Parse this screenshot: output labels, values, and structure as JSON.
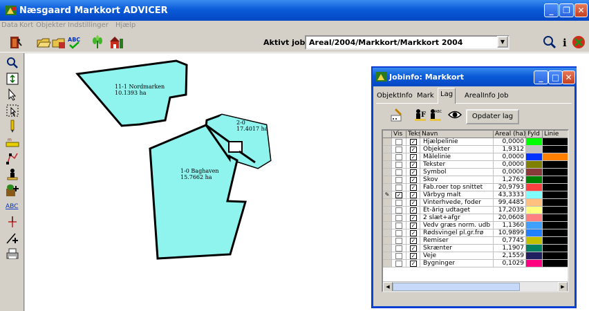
{
  "window": {
    "title": "Næsgaard Markkort ADVICER"
  },
  "menu": [
    "Data",
    "Kort",
    "Objekter",
    "Indstillinger",
    "Hjælp"
  ],
  "toolbar": {
    "aktivt_job_label": "Aktivt job",
    "job_value": "Areal/2004/Markkort/Markkort 2004"
  },
  "map": {
    "fields": [
      {
        "name": "11-1 Nordmarken",
        "area": "10.1393 ha"
      },
      {
        "name": "2-0",
        "area": "17.4017 ha"
      },
      {
        "name": "1-0 Baghaven",
        "area": "15.7662 ha"
      }
    ],
    "field_color": "#8ff3ee"
  },
  "jobinfo": {
    "title": "Jobinfo: Markkort",
    "tabs": [
      "ObjektInfo",
      "Mark",
      "Lag",
      "ArealInfo",
      "Job"
    ],
    "active_tab": "Lag",
    "update_button": "Opdater lag",
    "columns": [
      "Vis",
      "Tekst",
      "Navn",
      "Areal (ha)",
      "Fyld",
      "Linie"
    ],
    "rows": [
      {
        "vis": false,
        "tekst": true,
        "navn": "Hjælpelinie",
        "areal": "0,0000",
        "fyld": "#00ff00",
        "linie": "#000000"
      },
      {
        "vis": false,
        "tekst": true,
        "navn": "Objekter",
        "areal": "1,9312",
        "fyld": "#c0c0c0",
        "linie": "#000000"
      },
      {
        "vis": false,
        "tekst": true,
        "navn": "Målelinie",
        "areal": "0,0000",
        "fyld": "#0033ff",
        "linie": "#ff8000"
      },
      {
        "vis": false,
        "tekst": true,
        "navn": "Tekster",
        "areal": "0,0000",
        "fyld": "#808000",
        "linie": "#000000"
      },
      {
        "vis": false,
        "tekst": true,
        "navn": "Symbol",
        "areal": "0,0000",
        "fyld": "#8b3a3a",
        "linie": "#000000"
      },
      {
        "vis": false,
        "tekst": true,
        "navn": "Skov",
        "areal": "1,2762",
        "fyld": "#008000",
        "linie": "#000000"
      },
      {
        "vis": false,
        "tekst": true,
        "navn": "Fab.roer top snittet",
        "areal": "20,9793",
        "fyld": "#ff4040",
        "linie": "#000000"
      },
      {
        "vis": true,
        "tekst": true,
        "navn": "Vårbyg malt",
        "areal": "43,3333",
        "fyld": "#80ffff",
        "linie": "#000000",
        "selected": true
      },
      {
        "vis": false,
        "tekst": true,
        "navn": "Vinterhvede, foder",
        "areal": "99,4485",
        "fyld": "#ffc080",
        "linie": "#000000"
      },
      {
        "vis": false,
        "tekst": true,
        "navn": "Et-årig udtaget",
        "areal": "17,2039",
        "fyld": "#ffff80",
        "linie": "#000000"
      },
      {
        "vis": false,
        "tekst": true,
        "navn": "2 slæt+afgr",
        "areal": "20,0608",
        "fyld": "#ff8080",
        "linie": "#000000"
      },
      {
        "vis": false,
        "tekst": true,
        "navn": "Vedv græs norm. udb",
        "areal": "1,1360",
        "fyld": "#40a0ff",
        "linie": "#000000"
      },
      {
        "vis": false,
        "tekst": true,
        "navn": "Rødsvingel pl.gr.frø",
        "areal": "10,9899",
        "fyld": "#2080ff",
        "linie": "#000000"
      },
      {
        "vis": false,
        "tekst": true,
        "navn": "Remiser",
        "areal": "0,7745",
        "fyld": "#c0c000",
        "linie": "#000000"
      },
      {
        "vis": false,
        "tekst": true,
        "navn": "Skrænter",
        "areal": "1,1907",
        "fyld": "#008060",
        "linie": "#000000"
      },
      {
        "vis": false,
        "tekst": true,
        "navn": "Veje",
        "areal": "2,1559",
        "fyld": "#202060",
        "linie": "#000000"
      },
      {
        "vis": false,
        "tekst": true,
        "navn": "Bygninger",
        "areal": "0,1029",
        "fyld": "#ff0080",
        "linie": "#000000"
      }
    ]
  }
}
